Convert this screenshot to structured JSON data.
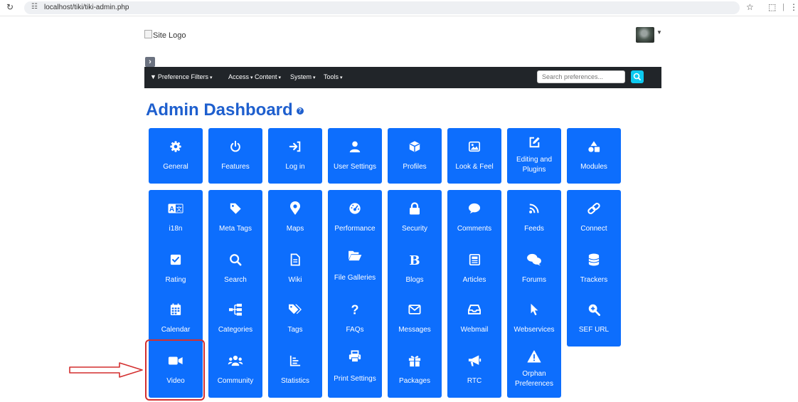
{
  "browser": {
    "url": "localhost/tiki/tiki-admin.php"
  },
  "header": {
    "logo_alt": "Site Logo"
  },
  "navbar": {
    "preference_filters": "Preference Filters",
    "access": "Access",
    "content": "Content",
    "system": "System",
    "tools": "Tools",
    "search_placeholder": "Search preferences..."
  },
  "page": {
    "title": "Admin Dashboard"
  },
  "tiles": [
    {
      "label": "General",
      "icon": "gear-icon"
    },
    {
      "label": "Features",
      "icon": "power-icon"
    },
    {
      "label": "Log in",
      "icon": "sign-in-icon"
    },
    {
      "label": "User Settings",
      "icon": "user-icon"
    },
    {
      "label": "Profiles",
      "icon": "cube-icon"
    },
    {
      "label": "Look & Feel",
      "icon": "image-icon"
    },
    {
      "label": "Editing and Plugins",
      "icon": "edit-icon"
    },
    {
      "label": "Modules",
      "icon": "shapes-icon"
    },
    {
      "label": "i18n",
      "icon": "language-icon"
    },
    {
      "label": "Meta Tags",
      "icon": "tag-icon"
    },
    {
      "label": "Maps",
      "icon": "map-marker-icon"
    },
    {
      "label": "Performance",
      "icon": "tachometer-icon"
    },
    {
      "label": "Security",
      "icon": "lock-icon"
    },
    {
      "label": "Comments",
      "icon": "comment-icon"
    },
    {
      "label": "Feeds",
      "icon": "rss-icon"
    },
    {
      "label": "Connect",
      "icon": "link-icon"
    },
    {
      "label": "Rating",
      "icon": "check-square-icon"
    },
    {
      "label": "Search",
      "icon": "search-icon"
    },
    {
      "label": "Wiki",
      "icon": "file-text-icon"
    },
    {
      "label": "File Galleries",
      "icon": "folder-open-icon"
    },
    {
      "label": "Blogs",
      "icon": "bold-icon"
    },
    {
      "label": "Articles",
      "icon": "newspaper-icon"
    },
    {
      "label": "Forums",
      "icon": "comments-icon"
    },
    {
      "label": "Trackers",
      "icon": "database-icon"
    },
    {
      "label": "Calendar",
      "icon": "calendar-icon"
    },
    {
      "label": "Categories",
      "icon": "sitemap-icon"
    },
    {
      "label": "Tags",
      "icon": "tags-icon"
    },
    {
      "label": "FAQs",
      "icon": "question-icon"
    },
    {
      "label": "Messages",
      "icon": "envelope-icon"
    },
    {
      "label": "Webmail",
      "icon": "inbox-icon"
    },
    {
      "label": "Webservices",
      "icon": "mouse-pointer-icon"
    },
    {
      "label": "SEF URL",
      "icon": "search-plus-icon"
    },
    {
      "label": "Video",
      "icon": "video-icon"
    },
    {
      "label": "Community",
      "icon": "users-icon"
    },
    {
      "label": "Statistics",
      "icon": "chart-bar-icon"
    },
    {
      "label": "Print Settings",
      "icon": "print-icon"
    },
    {
      "label": "Packages",
      "icon": "gift-icon"
    },
    {
      "label": "RTC",
      "icon": "bullhorn-icon"
    },
    {
      "label": "Orphan Preferences",
      "icon": "warning-icon"
    }
  ],
  "colors": {
    "tile_bg": "#0d6efd",
    "title": "#1e5fce",
    "navbar_bg": "#212529",
    "search_button": "#0dcaf0",
    "annotation": "#d32f2f"
  }
}
